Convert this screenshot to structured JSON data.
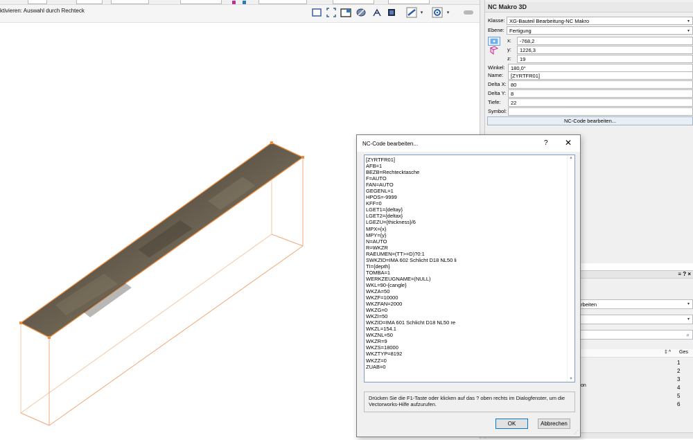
{
  "status_bar": {
    "hint": "ktivieren: Auswahl durch Rechteck"
  },
  "view_toolbar": {
    "icons": [
      "view-rectangle-icon",
      "fit-to-window-icon",
      "folder-view-icon",
      "flyover-icon",
      "walkthrough-icon",
      "render-camera-icon",
      "render-mode-icon",
      "settings-gear-icon",
      "toggle-icon"
    ]
  },
  "palette": {
    "title": "NC Makro 3D",
    "klasse_label": "Klasse:",
    "klasse_value": "XG-Bauteil Bearbeitung-NC Makro",
    "ebene_label": "Ebene:",
    "ebene_value": "Fertigung",
    "x_label": "x:",
    "x_value": "-768,2",
    "y_label": "y:",
    "y_value": "1226,3",
    "z_label": "z:",
    "z_value": "19",
    "winkel_label": "Winkel:",
    "winkel_value": "180,0°",
    "name_label": "Name:",
    "name_value": "[ZYRTFR01]",
    "delta_x_label": "Delta X:",
    "delta_x_value": "80",
    "delta_y_label": "Delta Y:",
    "delta_y_value": "8",
    "tiefe_label": "Tiefe:",
    "tiefe_value": "22",
    "symbol_label": "Symbol:",
    "symbol_value": "",
    "nc_button": "NC-Code bearbeiten..."
  },
  "lower_palette": {
    "head_icons": "≡ ? ×",
    "field1": "arbeiten",
    "column_sort": "‡ ^",
    "column_ges": "Ges",
    "partial_item": "on",
    "rows": [
      "1",
      "2",
      "3",
      "4",
      "5",
      "6"
    ]
  },
  "dialog": {
    "title": "NC-Code bearbeiten...",
    "help_glyph": "?",
    "close_glyph": "✕",
    "code_lines": [
      "[ZYRTFR01]",
      "AFB=1",
      "BEZB=Rechtecktasche",
      "F=AUTO",
      "FAN=AUTO",
      "GEGENL=1",
      "HPOS=-9999",
      "KFF=0",
      "LGET1={deltay}",
      "LGET2={deltax}",
      "LGEZU={thickness}/6",
      "MPX={x}",
      "MPY={y}",
      "N=AUTO",
      "R=WKZR",
      "RAEUMEN=(TT>=D)?0:1",
      "SWKZID=IMA 602 Schlicht D18 NL50 li",
      "TI={depth}",
      "TOMBA=1",
      "WERKZEUGNAME=(NULL)",
      "WKL=90-{cangle}",
      "WKZA=50",
      "WKZF=10000",
      "WKZFAN=2000",
      "WKZG=0",
      "WKZI=50",
      "WKZID=IMA 601 Schlicht D18 NL50 re",
      "WKZL=154.1",
      "WKZNL=50",
      "WKZR=9",
      "WKZS=18000",
      "WKZTYP=8192",
      "WKZZ=0",
      "ZUAB=0"
    ],
    "help_text_line1": "Drücken Sie die F1-Taste oder klicken auf das ? oben rechts im Dialogfenster, um die",
    "help_text_line2": "Vectorworks-Hilfe aufzurufen.",
    "ok_label": "OK",
    "cancel_label": "Abbrechen"
  },
  "colors": {
    "object_edge": "#f0a050",
    "object_top": "#5a5246",
    "accent": "#0078d7"
  }
}
